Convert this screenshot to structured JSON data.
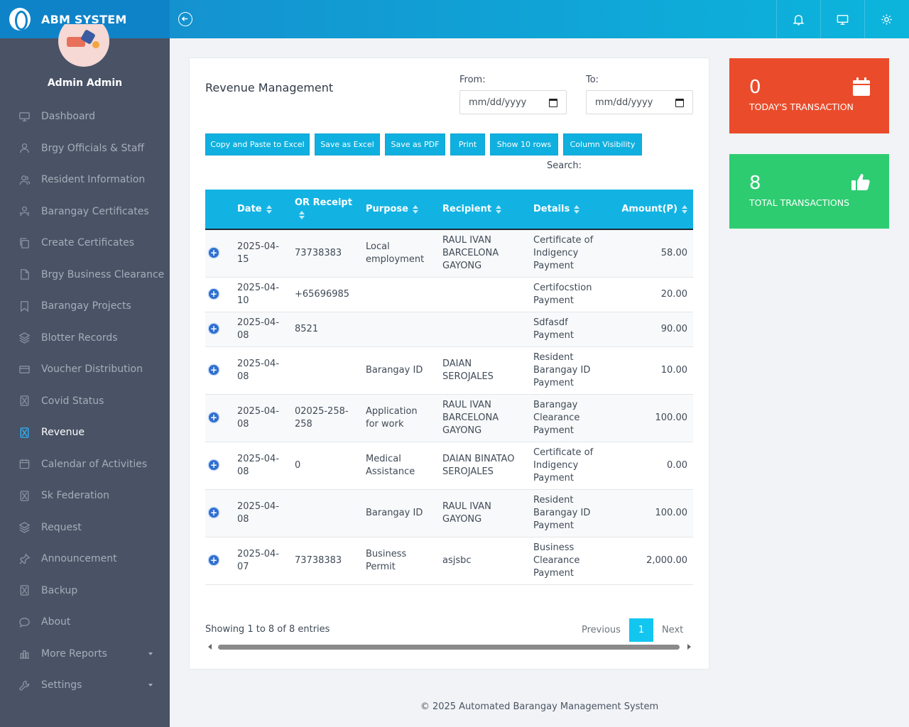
{
  "brand": {
    "title": "ABM SYSTEM"
  },
  "user": {
    "name": "Admin Admin"
  },
  "sidebar": {
    "items": [
      {
        "label": "Dashboard",
        "icon": "monitor-icon"
      },
      {
        "label": "Brgy Officials & Staff",
        "icon": "user-icon"
      },
      {
        "label": "Resident Information",
        "icon": "users-icon"
      },
      {
        "label": "Barangay Certificates",
        "icon": "people-icon"
      },
      {
        "label": "Create Certificates",
        "icon": "copy-icon"
      },
      {
        "label": "Brgy Business Clearance",
        "icon": "file-icon"
      },
      {
        "label": "Barangay Projects",
        "icon": "bookmark-icon"
      },
      {
        "label": "Blotter Records",
        "icon": "layers-icon"
      },
      {
        "label": "Voucher Distribution",
        "icon": "card-icon"
      },
      {
        "label": "Covid Status",
        "icon": "hourglass-icon"
      },
      {
        "label": "Revenue",
        "icon": "hourglass-icon",
        "active": true
      },
      {
        "label": "Calendar of Activities",
        "icon": "calendar-icon"
      },
      {
        "label": "Sk Federation",
        "icon": "hourglass-icon"
      },
      {
        "label": "Request",
        "icon": "layers-icon"
      },
      {
        "label": "Announcement",
        "icon": "pin-icon"
      },
      {
        "label": "Backup",
        "icon": "hourglass-icon"
      },
      {
        "label": "About",
        "icon": "chat-icon"
      },
      {
        "label": "More Reports",
        "icon": "bar-chart-icon",
        "dropdown": true
      },
      {
        "label": "Settings",
        "icon": "wrench-icon",
        "dropdown": true
      }
    ]
  },
  "main": {
    "title": "Revenue Management",
    "from_label": "From:",
    "to_label": "To:",
    "from_value": "mm/dd/yyyy",
    "to_value": "mm/dd/yyyy",
    "buttons": [
      "Copy and Paste to Excel",
      "Save as Excel",
      "Save as PDF",
      "Print",
      "Show 10 rows",
      "Column Visibility"
    ],
    "search_label": "Search:",
    "columns": [
      "Date",
      "OR Receipt",
      "Purpose",
      "Recipient",
      "Details",
      "Amount(P)"
    ],
    "rows": [
      {
        "date": "2025-04-15",
        "or": "73738383",
        "purpose": "Local employment",
        "recipient": "RAUL IVAN BARCELONA GAYONG",
        "details": "Certificate of Indigency Payment",
        "amount": "58.00"
      },
      {
        "date": "2025-04-10",
        "or": "+65696985",
        "purpose": "",
        "recipient": "",
        "details": "Certifocstion Payment",
        "amount": "20.00"
      },
      {
        "date": "2025-04-08",
        "or": "8521",
        "purpose": "",
        "recipient": "",
        "details": "Sdfasdf Payment",
        "amount": "90.00"
      },
      {
        "date": "2025-04-08",
        "or": "",
        "purpose": "Barangay ID",
        "recipient": "DAIAN SEROJALES",
        "details": "Resident Barangay ID Payment",
        "amount": "10.00"
      },
      {
        "date": "2025-04-08",
        "or": "02025-258-258",
        "purpose": "Application for work",
        "recipient": "RAUL IVAN BARCELONA GAYONG",
        "details": "Barangay Clearance Payment",
        "amount": "100.00"
      },
      {
        "date": "2025-04-08",
        "or": "0",
        "purpose": "Medical Assistance",
        "recipient": "DAIAN BINATAO SEROJALES",
        "details": "Certificate of Indigency Payment",
        "amount": "0.00"
      },
      {
        "date": "2025-04-08",
        "or": "",
        "purpose": "Barangay ID",
        "recipient": "RAUL IVAN GAYONG",
        "details": "Resident Barangay ID Payment",
        "amount": "100.00"
      },
      {
        "date": "2025-04-07",
        "or": "73738383",
        "purpose": "Business Permit",
        "recipient": "asjsbc",
        "details": "Business Clearance Payment",
        "amount": "2,000.00"
      }
    ],
    "showing": "Showing 1 to 8 of 8 entries",
    "pager": {
      "prev": "Previous",
      "current": "1",
      "next": "Next"
    }
  },
  "stats": {
    "today": {
      "value": "0",
      "label": "TODAY'S TRANSACTION",
      "color": "#ea4c2b"
    },
    "total": {
      "value": "8",
      "label": "TOTAL TRANSACTIONS",
      "color": "#2ecc71"
    }
  },
  "footer": {
    "text": "© 2025 Automated Barangay Management System"
  },
  "colors": {
    "accent": "#12b3e3",
    "sidebar": "#495365"
  }
}
